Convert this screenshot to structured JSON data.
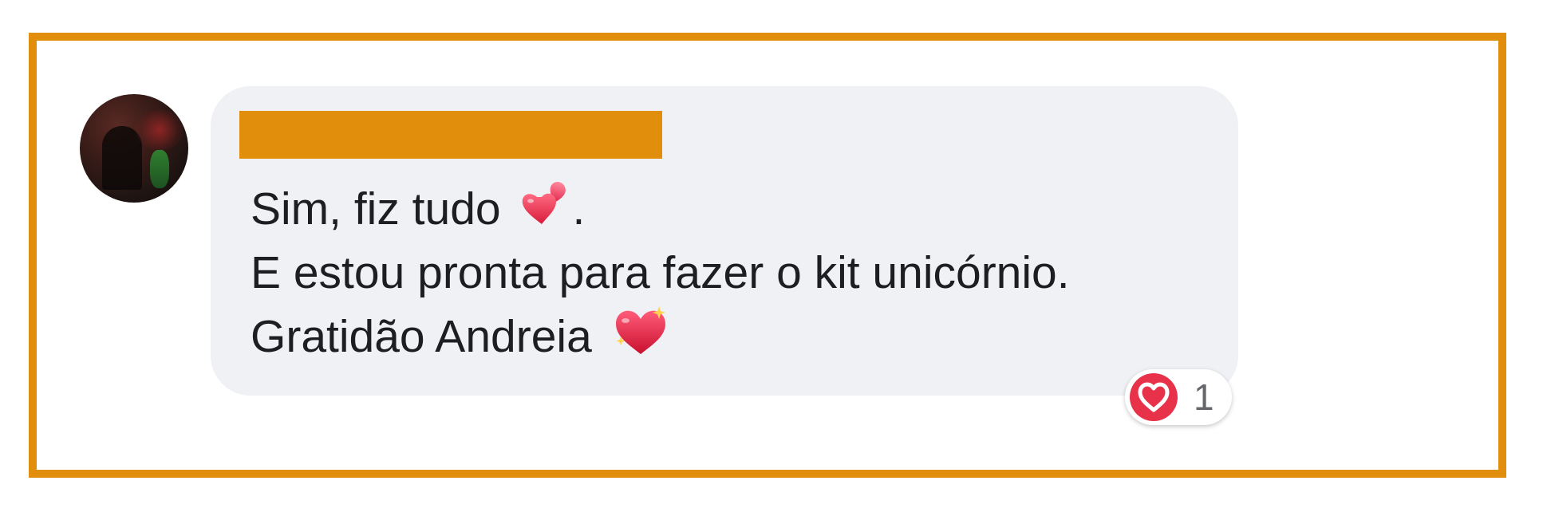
{
  "comment": {
    "lines": [
      "Sim, fiz tudo",
      ".",
      "E estou pronta para fazer o kit unicórnio.",
      "Gratidão Andreia"
    ],
    "emoji_1": "two-hearts-icon",
    "emoji_2": "sparkling-heart-icon"
  },
  "reaction": {
    "icon": "love-reaction-icon",
    "count": "1"
  },
  "colors": {
    "frame_border": "#E08E0B",
    "bubble_bg": "#F0F1F4",
    "text": "#1c1e21",
    "reaction_heart": "#E8324A",
    "reaction_count": "#65676b"
  }
}
